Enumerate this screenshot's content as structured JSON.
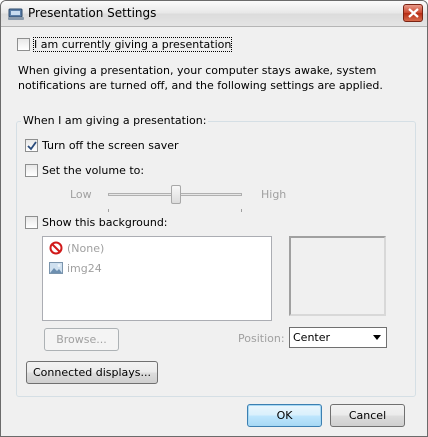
{
  "window": {
    "title": "Presentation Settings"
  },
  "main": {
    "presenting_checkbox": {
      "label": "I am currently giving a presentation",
      "checked": false
    },
    "description": [
      "When giving a presentation, your computer stays awake, system",
      "notifications are turned off, and the following settings are applied."
    ]
  },
  "group": {
    "label": "When I am giving a presentation:",
    "screensaver": {
      "label": "Turn off the screen saver",
      "checked": true
    },
    "volume": {
      "label": "Set the volume to:",
      "checked": false
    },
    "slider": {
      "low_label": "Low",
      "high_label": "High",
      "level": 0.5
    },
    "background": {
      "label": "Show this background:",
      "checked": false
    },
    "background_list": [
      {
        "label": "(None)",
        "icon": "no-symbol-icon"
      },
      {
        "label": "img24",
        "icon": "image-icon"
      }
    ],
    "browse_button": "Browse...",
    "position_label": "Position:",
    "position_value": "Center",
    "connected_displays_button": "Connected displays..."
  },
  "footer": {
    "ok_button": "OK",
    "cancel_button": "Cancel"
  },
  "colors": {
    "window_bg": "#f0f0f0",
    "check_mark": "#2a4b7c",
    "close_button": "#c9452d"
  }
}
